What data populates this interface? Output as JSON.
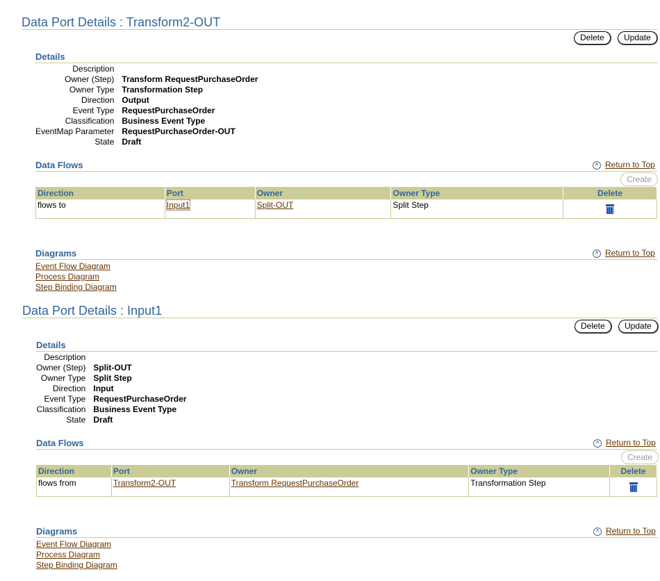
{
  "buttons": {
    "delete": "Delete",
    "update": "Update",
    "create": "Create"
  },
  "return_to_top": "Return to Top",
  "sections": [
    {
      "title": "Data Port Details : Transform2-OUT",
      "details_heading": "Details",
      "details": [
        {
          "label": "Description",
          "value": ""
        },
        {
          "label": "Owner (Step)",
          "value": "Transform RequestPurchaseOrder"
        },
        {
          "label": "Owner Type",
          "value": "Transformation Step"
        },
        {
          "label": "Direction",
          "value": "Output"
        },
        {
          "label": "Event Type",
          "value": "RequestPurchaseOrder"
        },
        {
          "label": "Classification",
          "value": "Business Event Type"
        },
        {
          "label": "EventMap Parameter",
          "value": "RequestPurchaseOrder-OUT"
        },
        {
          "label": "State",
          "value": "Draft"
        }
      ],
      "flows_heading": "Data Flows",
      "columns": [
        "Direction",
        "Port",
        "Owner",
        "Owner Type",
        "Delete"
      ],
      "rows": [
        {
          "direction": "flows to",
          "port": "Input1",
          "owner": "Split-OUT",
          "owner_type": "Split Step"
        }
      ],
      "diagrams_heading": "Diagrams",
      "diagrams": [
        "Event Flow Diagram",
        "Process Diagram",
        "Step Binding Diagram"
      ]
    },
    {
      "title": "Data Port Details : Input1",
      "details_heading": "Details",
      "details": [
        {
          "label": "Description",
          "value": ""
        },
        {
          "label": "Owner (Step)",
          "value": "Split-OUT"
        },
        {
          "label": "Owner Type",
          "value": "Split Step"
        },
        {
          "label": "Direction",
          "value": "Input"
        },
        {
          "label": "Event Type",
          "value": "RequestPurchaseOrder"
        },
        {
          "label": "Classification",
          "value": "Business Event Type"
        },
        {
          "label": "State",
          "value": "Draft"
        }
      ],
      "flows_heading": "Data Flows",
      "columns": [
        "Direction",
        "Port",
        "Owner",
        "Owner Type",
        "Delete"
      ],
      "rows": [
        {
          "direction": "flows from",
          "port": "Transform2-OUT",
          "owner": "Transform RequestPurchaseOrder",
          "owner_type": "Transformation Step"
        }
      ],
      "diagrams_heading": "Diagrams",
      "diagrams": [
        "Event Flow Diagram",
        "Process Diagram",
        "Step Binding Diagram"
      ]
    }
  ]
}
